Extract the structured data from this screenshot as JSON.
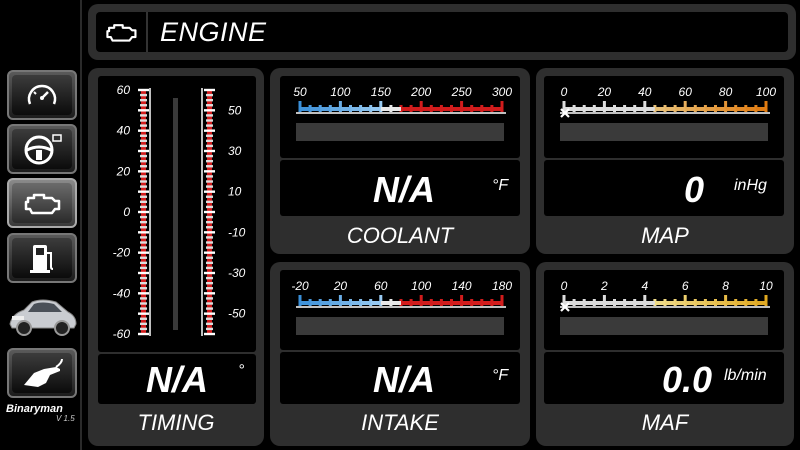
{
  "header": {
    "title": "ENGINE",
    "icon": "check-engine-icon"
  },
  "sidebar": {
    "items": [
      {
        "name": "gauge",
        "icon": "speedometer-icon",
        "active": false
      },
      {
        "name": "steering",
        "icon": "steering-wheel-icon",
        "active": false
      },
      {
        "name": "engine",
        "icon": "engine-icon",
        "active": true
      },
      {
        "name": "fuel",
        "icon": "fuel-pump-icon",
        "active": false
      },
      {
        "name": "car",
        "icon": "car-image",
        "active": false
      },
      {
        "name": "refuel",
        "icon": "fuel-nozzle-icon",
        "active": false
      }
    ],
    "brand": "Binaryman",
    "version": "V 1.5"
  },
  "timing": {
    "label": "TIMING",
    "value": "N/A",
    "unit": "°",
    "left_ticks": [
      "60",
      "40",
      "20",
      "0",
      "-20",
      "-40",
      "-60"
    ],
    "right_ticks": [
      "50",
      "30",
      "10",
      "-10",
      "-30",
      "-50"
    ]
  },
  "coolant": {
    "label": "COOLANT",
    "value": "N/A",
    "unit": "°F",
    "ticks": [
      "50",
      "100",
      "150",
      "200",
      "250",
      "300"
    ]
  },
  "map": {
    "label": "MAP",
    "value": "0",
    "unit": "inHg",
    "ticks": [
      "0",
      "20",
      "40",
      "60",
      "80",
      "100"
    ]
  },
  "intake": {
    "label": "INTAKE",
    "value": "N/A",
    "unit": "°F",
    "ticks": [
      "-20",
      "20",
      "60",
      "100",
      "140",
      "180"
    ]
  },
  "maf": {
    "label": "MAF",
    "value": "0.0",
    "unit": "lb/min",
    "ticks": [
      "0",
      "2",
      "4",
      "6",
      "8",
      "10"
    ]
  },
  "colors": {
    "panel": "#2e2e2e",
    "cold": "#3a8fd8",
    "hot": "#d21c1c",
    "orange": "#e07a10",
    "yellow": "#e0a820"
  }
}
